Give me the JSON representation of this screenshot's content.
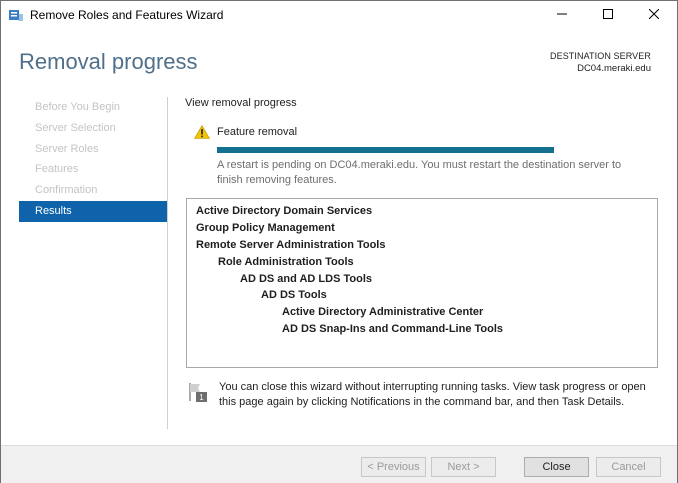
{
  "window": {
    "title": "Remove Roles and Features Wizard",
    "icons": {
      "app": "server-manager-icon",
      "minimize": "minimize-icon",
      "maximize": "maximize-icon",
      "close": "close-icon"
    }
  },
  "header": {
    "title": "Removal progress",
    "destination_label": "DESTINATION SERVER",
    "destination_server": "DC04.meraki.edu"
  },
  "nav": {
    "items": [
      {
        "label": "Before You Begin",
        "state": "disabled"
      },
      {
        "label": "Server Selection",
        "state": "disabled"
      },
      {
        "label": "Server Roles",
        "state": "disabled"
      },
      {
        "label": "Features",
        "state": "disabled"
      },
      {
        "label": "Confirmation",
        "state": "disabled"
      },
      {
        "label": "Results",
        "state": "active"
      }
    ]
  },
  "main": {
    "section_label": "View removal progress",
    "feature_removal": {
      "label": "Feature removal",
      "icon": "warning-icon",
      "progress_percent": 100,
      "message": "A restart is pending on DC04.meraki.edu. You must restart the destination server to finish removing features."
    },
    "results": [
      {
        "text": "Active Directory Domain Services",
        "level": 0
      },
      {
        "text": "Group Policy Management",
        "level": 0
      },
      {
        "text": "Remote Server Administration Tools",
        "level": 0
      },
      {
        "text": "Role Administration Tools",
        "level": 1
      },
      {
        "text": "AD DS and AD LDS Tools",
        "level": 2
      },
      {
        "text": "AD DS Tools",
        "level": 3
      },
      {
        "text": "Active Directory Administrative Center",
        "level": 4
      },
      {
        "text": "AD DS Snap-Ins and Command-Line Tools",
        "level": 4
      }
    ],
    "note": {
      "icon": "notification-flag-icon",
      "text": "You can close this wizard without interrupting running tasks. View task progress or open this page again by clicking Notifications in the command bar, and then Task Details."
    }
  },
  "footer": {
    "previous": "< Previous",
    "next": "Next >",
    "close": "Close",
    "cancel": "Cancel"
  },
  "colors": {
    "title_accent": "#4f6f8a",
    "nav_active": "#0e63aa",
    "progress": "#14708f",
    "warning": "#f5c400"
  }
}
